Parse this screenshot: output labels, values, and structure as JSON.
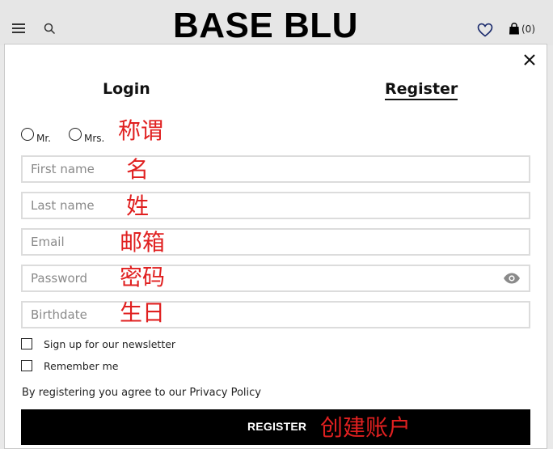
{
  "header": {
    "logo": "BASE BLU",
    "bag_count": "(0)"
  },
  "modal": {
    "tabs": {
      "login": "Login",
      "register": "Register"
    },
    "title_options": {
      "mr": "Mr.",
      "mrs": "Mrs."
    },
    "fields": {
      "first_name": "First name",
      "last_name": "Last name",
      "email": "Email",
      "password": "Password",
      "birthdate": "Birthdate"
    },
    "checkboxes": {
      "newsletter": "Sign up for our newsletter",
      "remember": "Remember me"
    },
    "agree_text": "By registering you agree to our Privacy Policy",
    "register_button": "REGISTER"
  },
  "annotations": {
    "title": "称谓",
    "first_name": "名",
    "last_name": "姓",
    "email": "邮箱",
    "password": "密码",
    "birthdate": "生日",
    "register": "创建账户"
  },
  "colors": {
    "annotation": "#e02020",
    "button_bg": "#000000",
    "header_bg": "#e6e6e6"
  }
}
